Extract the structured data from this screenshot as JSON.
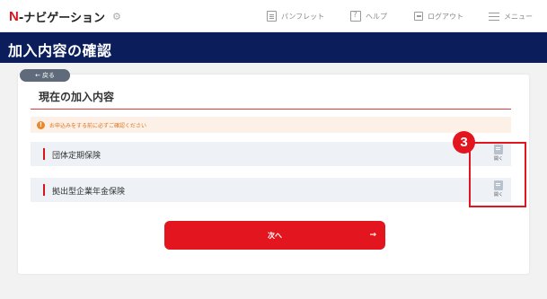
{
  "header": {
    "logo_mark": "N",
    "logo_text": "-ナビゲーション",
    "gear_icon": "gear-icon",
    "nav": {
      "pamphlet": "パンフレット",
      "help": "ヘルプ",
      "logout": "ログアウト",
      "menu": "メニュー"
    }
  },
  "page": {
    "title": "加入内容の確認"
  },
  "content": {
    "back_label": "戻る",
    "section_title": "現在の加入内容",
    "notice_text": "お申込みをする前に必ずご確認ください",
    "plans": [
      {
        "label": "団体定期保険",
        "open_label": "開く"
      },
      {
        "label": "拠出型企業年金保険",
        "open_label": "開く"
      }
    ],
    "next_label": "次へ",
    "next_arrow": "→"
  },
  "annotation": {
    "step_number": "3"
  },
  "colors": {
    "brand_red": "#e3151e",
    "navy": "#0b1e5b",
    "notice_bg": "#fdf1e7",
    "row_bg": "#eef2f7"
  }
}
